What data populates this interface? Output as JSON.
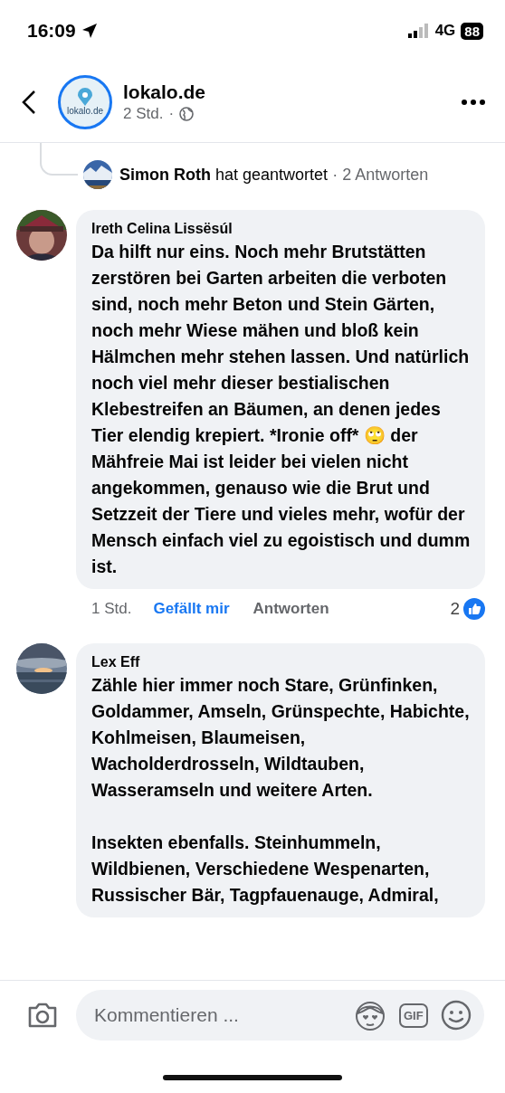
{
  "status_bar": {
    "time": "16:09",
    "network": "4G",
    "battery": "88"
  },
  "header": {
    "page_name": "lokalo.de",
    "logo_text": "lokalo.de",
    "age": "2 Std.",
    "separator": "·"
  },
  "reply_summary": {
    "author": "Simon Roth",
    "action": "hat geantwortet",
    "separator": "·",
    "count": "2 Antworten"
  },
  "comments": [
    {
      "author": "Ireth Celina Lissësúl",
      "text": "Da hilft nur eins. Noch mehr Brutstätten zerstören bei Garten arbeiten die verboten sind, noch mehr Beton und Stein Gärten, noch mehr Wiese mähen und bloß kein Hälmchen mehr stehen lassen. Und natürlich noch viel mehr dieser bestialischen Klebestreifen an Bäumen, an denen jedes Tier elendig krepiert. *Ironie off* 🙄 der Mähfreie Mai ist leider bei vielen nicht angekommen, genauso wie die Brut und Setzzeit der Tiere und vieles mehr, wofür der Mensch einfach viel zu egoistisch und dumm ist.",
      "time": "1 Std.",
      "like_label": "Gefällt mir",
      "liked": true,
      "reply_label": "Antworten",
      "reactions": "2"
    },
    {
      "author": "Lex Eff",
      "text": "Zähle hier immer noch Stare, Grünfinken, Goldammer, Amseln, Grünspechte, Habichte, Kohlmeisen, Blaumeisen, Wacholderdrosseln, Wildtauben, Wasseramseln und weitere Arten.\n\nInsekten ebenfalls. Steinhummeln, Wildbienen, Verschiedene Wespenarten, Russischer Bär, Tagpfauenauge, Admiral,"
    }
  ],
  "composer": {
    "placeholder": "Kommentieren ...",
    "gif_label": "GIF"
  }
}
